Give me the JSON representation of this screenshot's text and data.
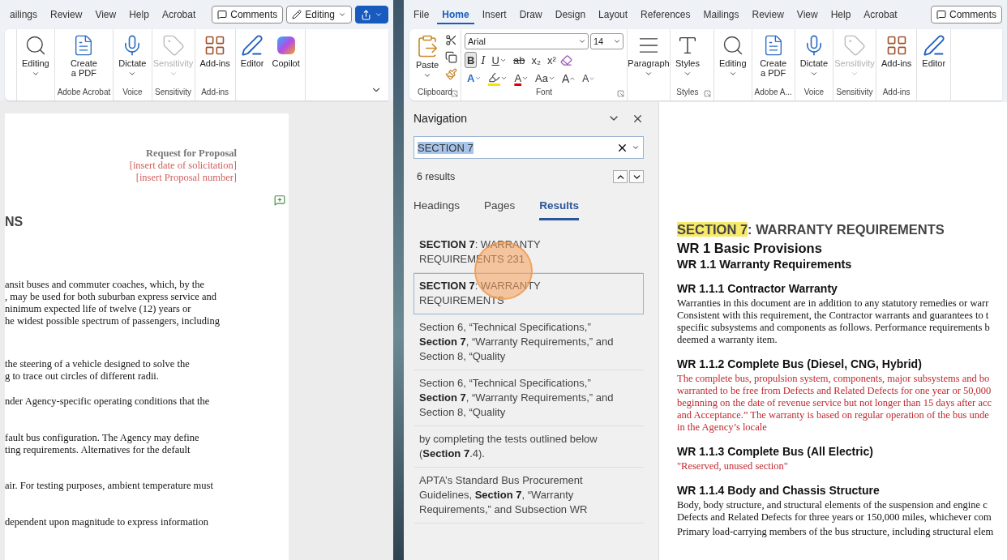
{
  "left_window": {
    "tabs": [
      {
        "label": "ailings",
        "selected": false
      },
      {
        "label": "Review",
        "selected": false
      },
      {
        "label": "View",
        "selected": false
      },
      {
        "label": "Help",
        "selected": false
      },
      {
        "label": "Acrobat",
        "selected": false
      }
    ],
    "comments_button": "Comments",
    "mode_button": "Editing",
    "ribbon_groups": [
      {
        "buttons": [
          {
            "kind": "editing",
            "label": "Editing",
            "dropdown": true,
            "disabled": false
          }
        ]
      },
      {
        "label": "Adobe Acrobat",
        "buttons": [
          {
            "kind": "pdf",
            "label": "Create a PDF",
            "dropdown": false,
            "disabled": false
          }
        ]
      },
      {
        "label": "Voice",
        "buttons": [
          {
            "kind": "dictate",
            "label": "Dictate",
            "dropdown": true,
            "disabled": false
          }
        ]
      },
      {
        "label": "Sensitivity",
        "buttons": [
          {
            "kind": "sensitivity",
            "label": "Sensitivity",
            "dropdown": true,
            "disabled": true
          }
        ]
      },
      {
        "label": "Add-ins",
        "buttons": [
          {
            "kind": "addins",
            "label": "Add-ins",
            "dropdown": false,
            "disabled": false
          }
        ]
      },
      {
        "buttons": [
          {
            "kind": "editor",
            "label": "Editor",
            "dropdown": false,
            "disabled": false
          },
          {
            "kind": "copilot",
            "label": "Copilot",
            "dropdown": false,
            "disabled": false
          }
        ]
      }
    ],
    "document": {
      "header": [
        {
          "kind": "title",
          "text": "Request for Proposal"
        },
        {
          "kind": "placeholder",
          "text": "[insert date of solicitation]"
        },
        {
          "kind": "placeholder",
          "text": "[insert Proposal number]"
        }
      ],
      "heading": "NS",
      "paragraphs": [
        [
          "ansit buses and commuter coaches, which, by the",
          ", may be used for both suburban express service and",
          "ninimum expected life of twelve (12) years or",
          "he widest possible spectrum of passengers, including"
        ],
        [
          "the steering of a vehicle designed to solve the",
          "g to trace out circles of different radii."
        ],
        [
          "nder Agency-specific operating conditions that the"
        ],
        [
          "fault bus configuration. The Agency may define",
          "ting requirements. Alternatives for the default"
        ],
        [
          "air. For testing purposes, ambient temperature must"
        ],
        [
          "dependent upon magnitude to express information"
        ]
      ]
    }
  },
  "right_window": {
    "tabs": [
      {
        "label": "File",
        "selected": false
      },
      {
        "label": "Home",
        "selected": true
      },
      {
        "label": "Insert",
        "selected": false
      },
      {
        "label": "Draw",
        "selected": false
      },
      {
        "label": "Design",
        "selected": false
      },
      {
        "label": "Layout",
        "selected": false
      },
      {
        "label": "References",
        "selected": false
      },
      {
        "label": "Mailings",
        "selected": false
      },
      {
        "label": "Review",
        "selected": false
      },
      {
        "label": "View",
        "selected": false
      },
      {
        "label": "Help",
        "selected": false
      },
      {
        "label": "Acrobat",
        "selected": false
      }
    ],
    "comments_button": "Comments",
    "clipboard": {
      "label": "Clipboard",
      "paste": "Paste"
    },
    "font": {
      "label": "Font",
      "name": "Arial",
      "size": "14",
      "row1": [
        {
          "label": "B",
          "kind": "bold",
          "on": true,
          "dropdown": false
        },
        {
          "label": "I",
          "kind": "italic",
          "on": false,
          "dropdown": false
        },
        {
          "label": "U",
          "kind": "underline",
          "on": false,
          "dropdown": true
        },
        {
          "label": "ab",
          "kind": "strike",
          "on": false,
          "dropdown": false
        },
        {
          "label": "x₂",
          "kind": "plain",
          "on": false,
          "dropdown": false
        },
        {
          "label": "x²",
          "kind": "plain",
          "on": false,
          "dropdown": false
        }
      ],
      "row2": [
        {
          "label": "A",
          "kind": "effects",
          "dropdown": true
        },
        {
          "kind": "highlight",
          "dropdown": true
        },
        {
          "label": "A",
          "kind": "color",
          "dropdown": true
        },
        {
          "label": "Aa",
          "kind": "plain",
          "dropdown": true
        },
        {
          "label": "A",
          "kind": "grow",
          "dropdown": false
        },
        {
          "label": "A",
          "kind": "shrink",
          "dropdown": false
        }
      ]
    },
    "ribbon_groups": [
      {
        "buttons": [
          {
            "kind": "paragraph",
            "label": "Paragraph",
            "dropdown": true,
            "disabled": false
          }
        ]
      },
      {
        "label": "Styles",
        "launcher": true,
        "buttons": [
          {
            "kind": "styles",
            "label": "Styles",
            "dropdown": true,
            "disabled": false
          }
        ]
      },
      {
        "buttons": [
          {
            "kind": "editing",
            "label": "Editing",
            "dropdown": true,
            "disabled": false
          }
        ]
      },
      {
        "label": "Adobe A...",
        "buttons": [
          {
            "kind": "pdf",
            "label": "Create a PDF",
            "dropdown": false,
            "disabled": false
          }
        ]
      },
      {
        "label": "Voice",
        "buttons": [
          {
            "kind": "dictate",
            "label": "Dictate",
            "dropdown": true,
            "disabled": false
          }
        ]
      },
      {
        "label": "Sensitivity",
        "buttons": [
          {
            "kind": "sensitivity",
            "label": "Sensitivity",
            "dropdown": true,
            "disabled": true
          }
        ]
      },
      {
        "label": "Add-ins",
        "buttons": [
          {
            "kind": "addins",
            "label": "Add-ins",
            "dropdown": false,
            "disabled": false
          }
        ]
      },
      {
        "buttons": [
          {
            "kind": "editor",
            "label": "Editor",
            "dropdown": false,
            "disabled": false
          }
        ]
      }
    ],
    "navigation": {
      "title": "Navigation",
      "search_value": "SECTION 7",
      "result_count": "6 results",
      "tabs": [
        {
          "label": "Headings",
          "selected": false
        },
        {
          "label": "Pages",
          "selected": false
        },
        {
          "label": "Results",
          "selected": true
        }
      ],
      "results": [
        {
          "text": "**SECTION 7**: WARRANTY REQUIREMENTS 231",
          "selected": false
        },
        {
          "text": "**SECTION 7**: WARRANTY REQUIREMENTS",
          "selected": true
        },
        {
          "text": "Section 6, “Technical Specifications,” **Section 7**, “Warranty Requirements,” and Section 8, “Quality",
          "selected": false
        },
        {
          "text": "Section 6, “Technical Specifications,” **Section 7**, “Warranty Requirements,” and Section 8, “Quality",
          "selected": false
        },
        {
          "text": "by completing the tests outlined below (**Section 7**.4).",
          "selected": false
        },
        {
          "text": "APTA’s Standard Bus Procurement Guidelines, **Section 7**, “Warranty Requirements,” and Subsection WR",
          "selected": false
        }
      ]
    },
    "document": {
      "blocks": [
        {
          "kind": "section",
          "highlight": "SECTION 7",
          "text": ": WARRANTY REQUIREMENTS"
        },
        {
          "kind": "h1",
          "text": "WR 1 Basic Provisions"
        },
        {
          "kind": "h2",
          "text": "WR 1.1 Warranty Requirements"
        },
        {
          "kind": "h3",
          "text": "WR 1.1.1 Contractor Warranty"
        },
        {
          "kind": "body",
          "lines": [
            "Warranties in this document are in addition to any statutory remedies or warr",
            "Consistent with this requirement, the Contractor warrants and guarantees to t",
            "specific subsystems and components as follows. Performance requirements b",
            "deemed a warranty item."
          ]
        },
        {
          "kind": "h3",
          "text": "WR 1.1.2 Complete Bus (Diesel, CNG, Hybrid)"
        },
        {
          "kind": "red",
          "lines": [
            "The complete bus, propulsion system, components, major subsystems and bo",
            "warranted to be free from Defects and Related Defects for one year or 50,000",
            "beginning on the date of revenue service but not longer than 15 days after acc",
            "and Acceptance.” The warranty is based on regular operation of the bus unde",
            "in the Agency’s locale"
          ]
        },
        {
          "kind": "h3",
          "text": "WR 1.1.3 Complete Bus (All Electric)"
        },
        {
          "kind": "red",
          "lines": [
            "\"Reserved, unused section\""
          ]
        },
        {
          "kind": "h3",
          "text": "WR 1.1.4 Body and Chassis Structure"
        },
        {
          "kind": "body",
          "lines": [
            "Body, body structure, and structural elements of the suspension and engine c",
            "Defects and Related Defects for three years or 150,000 miles, whichever com"
          ]
        },
        {
          "kind": "body",
          "lines": [
            "Primary load-carrying members of the bus structure, including structural elem"
          ]
        }
      ]
    }
  }
}
